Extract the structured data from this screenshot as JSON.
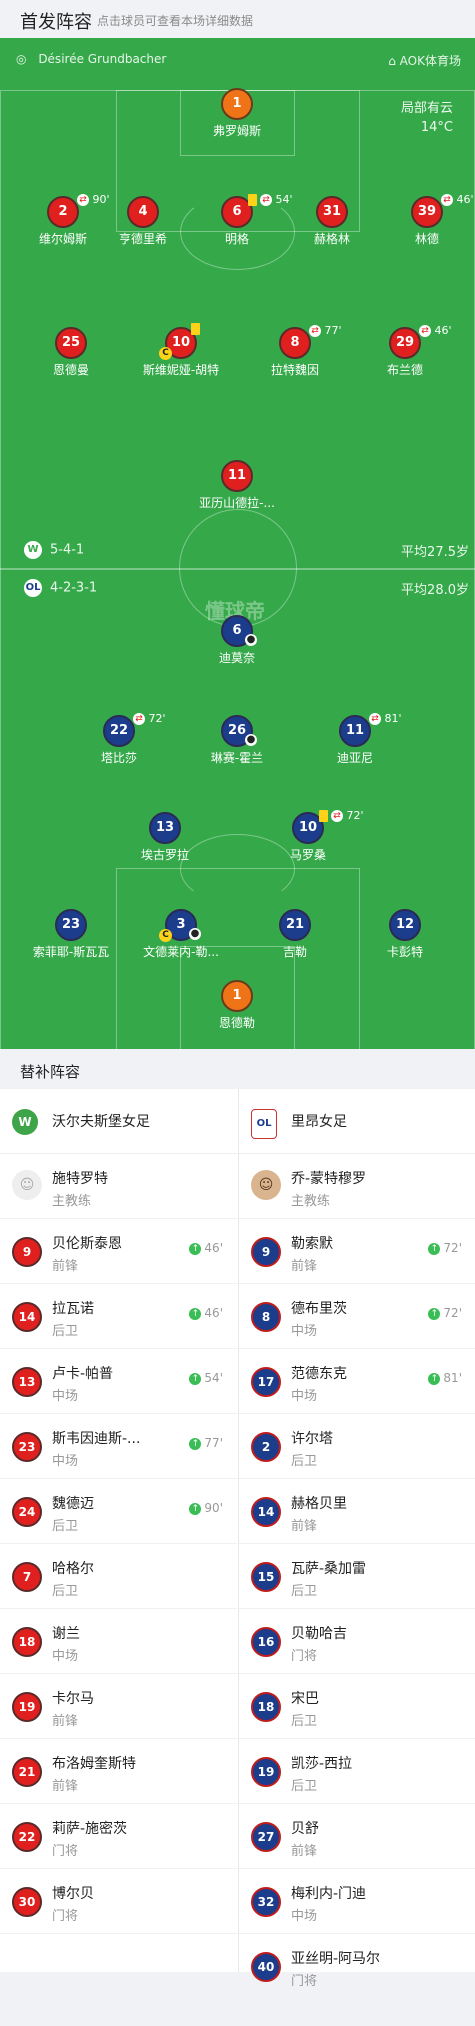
{
  "header": {
    "title": "首发阵容",
    "subtitle": "点击球员可查看本场详细数据"
  },
  "match": {
    "referee": "Désirée Grundbacher",
    "venue": "AOK体育场",
    "weather": "局部有云",
    "temperature": "14°C"
  },
  "home": {
    "formation": "5-4-1",
    "avg_age": "平均27.5岁",
    "players": [
      {
        "num": "1",
        "name": "弗罗姆斯",
        "gk": true
      },
      {
        "num": "2",
        "name": "维尔姆斯",
        "sub": "90'"
      },
      {
        "num": "4",
        "name": "亨德里希"
      },
      {
        "num": "6",
        "name": "明格",
        "sub": "54'"
      },
      {
        "num": "31",
        "name": "赫格林"
      },
      {
        "num": "39",
        "name": "林德",
        "sub": "46'"
      },
      {
        "num": "25",
        "name": "恩德曼"
      },
      {
        "num": "10",
        "name": "斯维妮娅-胡特"
      },
      {
        "num": "8",
        "name": "拉特魏因",
        "sub": "77'"
      },
      {
        "num": "29",
        "name": "布兰德",
        "sub": "46'"
      },
      {
        "num": "11",
        "name": "亚历山德拉-..."
      }
    ]
  },
  "away": {
    "formation": "4-2-3-1",
    "avg_age": "平均28.0岁",
    "players": [
      {
        "num": "6",
        "name": "迪莫奈"
      },
      {
        "num": "22",
        "name": "塔比莎",
        "sub": "72'"
      },
      {
        "num": "26",
        "name": "琳赛-霍兰"
      },
      {
        "num": "11",
        "name": "迪亚尼",
        "sub": "81'"
      },
      {
        "num": "13",
        "name": "埃古罗拉"
      },
      {
        "num": "10",
        "name": "马罗桑",
        "sub": "72'"
      },
      {
        "num": "23",
        "name": "索菲耶-斯瓦瓦"
      },
      {
        "num": "3",
        "name": "文德莱内-勒..."
      },
      {
        "num": "21",
        "name": "吉勒"
      },
      {
        "num": "12",
        "name": "卡彭特"
      },
      {
        "num": "1",
        "name": "恩德勒",
        "gk": true
      }
    ]
  },
  "watermark": "懂球帝",
  "bench": {
    "title": "替补阵容",
    "home": {
      "team": "沃尔夫斯堡女足",
      "logo": "W",
      "coach": {
        "name": "施特罗特",
        "role": "主教练"
      },
      "players": [
        {
          "num": "9",
          "name": "贝伦斯泰恩",
          "pos": "前锋",
          "time": "46'"
        },
        {
          "num": "14",
          "name": "拉瓦诺",
          "pos": "后卫",
          "time": "46'"
        },
        {
          "num": "13",
          "name": "卢卡-帕普",
          "pos": "中场",
          "time": "54'"
        },
        {
          "num": "23",
          "name": "斯韦因迪斯-...",
          "pos": "中场",
          "time": "77'"
        },
        {
          "num": "24",
          "name": "魏德迈",
          "pos": "后卫",
          "time": "90'"
        },
        {
          "num": "7",
          "name": "哈格尔",
          "pos": "后卫"
        },
        {
          "num": "18",
          "name": "谢兰",
          "pos": "中场"
        },
        {
          "num": "19",
          "name": "卡尔马",
          "pos": "前锋"
        },
        {
          "num": "21",
          "name": "布洛姆奎斯特",
          "pos": "前锋"
        },
        {
          "num": "22",
          "name": "莉萨-施密茨",
          "pos": "门将"
        },
        {
          "num": "30",
          "name": "博尔贝",
          "pos": "门将"
        }
      ]
    },
    "away": {
      "team": "里昂女足",
      "logo": "OL",
      "coach": {
        "name": "乔-蒙特穆罗",
        "role": "主教练"
      },
      "players": [
        {
          "num": "9",
          "name": "勒索默",
          "pos": "前锋",
          "time": "72'"
        },
        {
          "num": "8",
          "name": "德布里茨",
          "pos": "中场",
          "time": "72'"
        },
        {
          "num": "17",
          "name": "范德东克",
          "pos": "中场",
          "time": "81'"
        },
        {
          "num": "2",
          "name": "许尔塔",
          "pos": "后卫"
        },
        {
          "num": "14",
          "name": "赫格贝里",
          "pos": "前锋"
        },
        {
          "num": "15",
          "name": "瓦萨-桑加雷",
          "pos": "后卫"
        },
        {
          "num": "16",
          "name": "贝勒哈吉",
          "pos": "门将"
        },
        {
          "num": "18",
          "name": "宋巴",
          "pos": "后卫"
        },
        {
          "num": "19",
          "name": "凯莎-西拉",
          "pos": "后卫"
        },
        {
          "num": "27",
          "name": "贝舒",
          "pos": "前锋"
        },
        {
          "num": "32",
          "name": "梅利内-门迪",
          "pos": "中场"
        },
        {
          "num": "40",
          "name": "亚丝明-阿马尔",
          "pos": "门将"
        }
      ]
    }
  }
}
